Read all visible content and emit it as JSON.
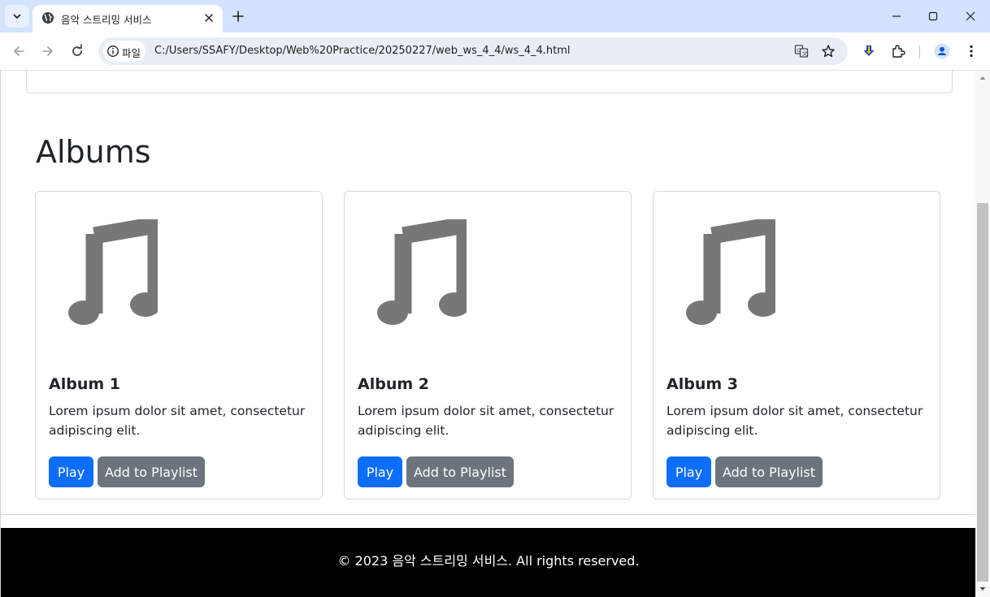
{
  "browser": {
    "tab_title": "음악 스트리밍 서비스",
    "site_chip_label": "파일",
    "url": "C:/Users/SSAFY/Desktop/Web%20Practice/20250227/web_ws_4_4/ws_4_4.html"
  },
  "page": {
    "albums_heading": "Albums",
    "albums": [
      {
        "title": "Album 1",
        "description": "Lorem ipsum dolor sit amet, consectetur adipiscing elit.",
        "play_label": "Play",
        "add_label": "Add to Playlist"
      },
      {
        "title": "Album 2",
        "description": "Lorem ipsum dolor sit amet, consectetur adipiscing elit.",
        "play_label": "Play",
        "add_label": "Add to Playlist"
      },
      {
        "title": "Album 3",
        "description": "Lorem ipsum dolor sit amet, consectetur adipiscing elit.",
        "play_label": "Play",
        "add_label": "Add to Playlist"
      }
    ],
    "footer_text": "© 2023 음악 스트리밍 서비스. All rights reserved."
  },
  "colors": {
    "play_button": "#0d6efd",
    "playlist_button": "#6c757d",
    "footer_background": "#000000",
    "music_icon": "#777777",
    "tabstrip": "#d3e3fd"
  },
  "icons": {
    "tab_search": "chevron-down-icon",
    "favicon": "globe-icon",
    "album_art": "music-note-icon",
    "toolbar": [
      "back-icon",
      "forward-icon",
      "reload-icon",
      "translate-icon",
      "star-icon",
      "download-icon",
      "extensions-icon",
      "profile-icon",
      "more-icon"
    ]
  }
}
